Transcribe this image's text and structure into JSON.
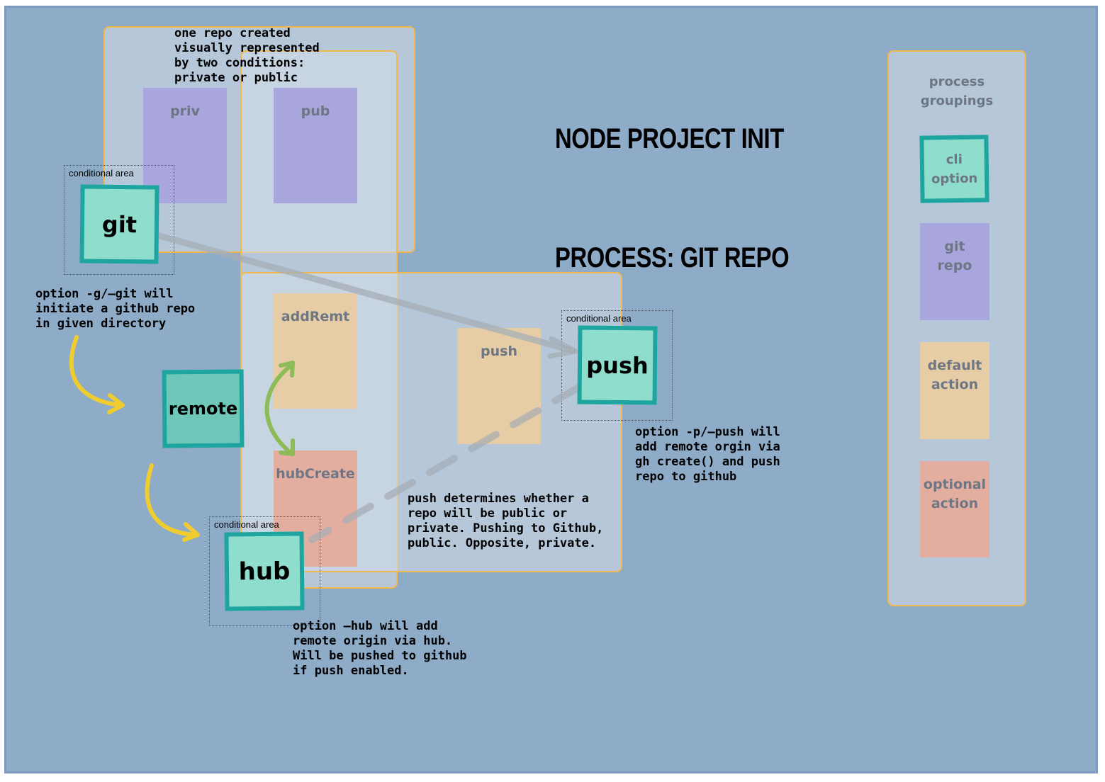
{
  "title": {
    "line1": "NODE PROJECT INIT",
    "line2": "PROCESS: GIT REPO"
  },
  "groups": {
    "priv": "priv",
    "pub": "pub",
    "addRemt": "addRemt",
    "hubCreate": "hubCreate",
    "push_action": "push"
  },
  "cli_options": {
    "git": "git",
    "remote": "remote",
    "hub": "hub",
    "push": "push"
  },
  "conditional_label": "conditional area",
  "notes": {
    "repo": "one repo created\nvisually represented\nby two conditions:\nprivate or public",
    "git": "option -g/—git will\ninitiate a github repo\nin given directory",
    "push_determines": "push determines whether a\nrepo will be public or\nprivate. Pushing to Github,\npublic. Opposite, private.",
    "push_option": "option -p/—push will\nadd remote orgin via\ngh create() and push\nrepo to github",
    "hub_option": "option —hub will add\nremote origin via hub.\nWill be pushed to github\nif push enabled."
  },
  "legend": {
    "heading": "process\ngroupings",
    "cli": "cli\noption",
    "git_repo": "git\nrepo",
    "default": "default\naction",
    "optional": "optional\naction"
  },
  "colors": {
    "background": "#8eabc8",
    "cli_fill": "#8fddcc",
    "cli_border": "#1fa5a0",
    "git_repo": "#a8a6dc",
    "default_action": "#e6cda6",
    "optional_action": "#e3aea0",
    "group_border": "#f2b84b",
    "flow_arrow": "#f0cd2e",
    "swap_arrow": "#8dbb57"
  }
}
